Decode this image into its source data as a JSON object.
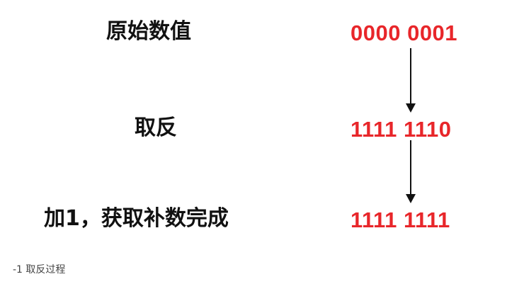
{
  "steps": [
    {
      "label": "原始数值",
      "value": "0000 0001"
    },
    {
      "label": "取反",
      "value": "1111 1110"
    },
    {
      "label": "加1，获取补数完成",
      "value": "1111 1111"
    }
  ],
  "caption": "-1 取反过程",
  "colors": {
    "value": "#e8262a",
    "label": "#111111",
    "arrow": "#111111"
  },
  "icons": {
    "arrow": "arrow-down-icon"
  }
}
